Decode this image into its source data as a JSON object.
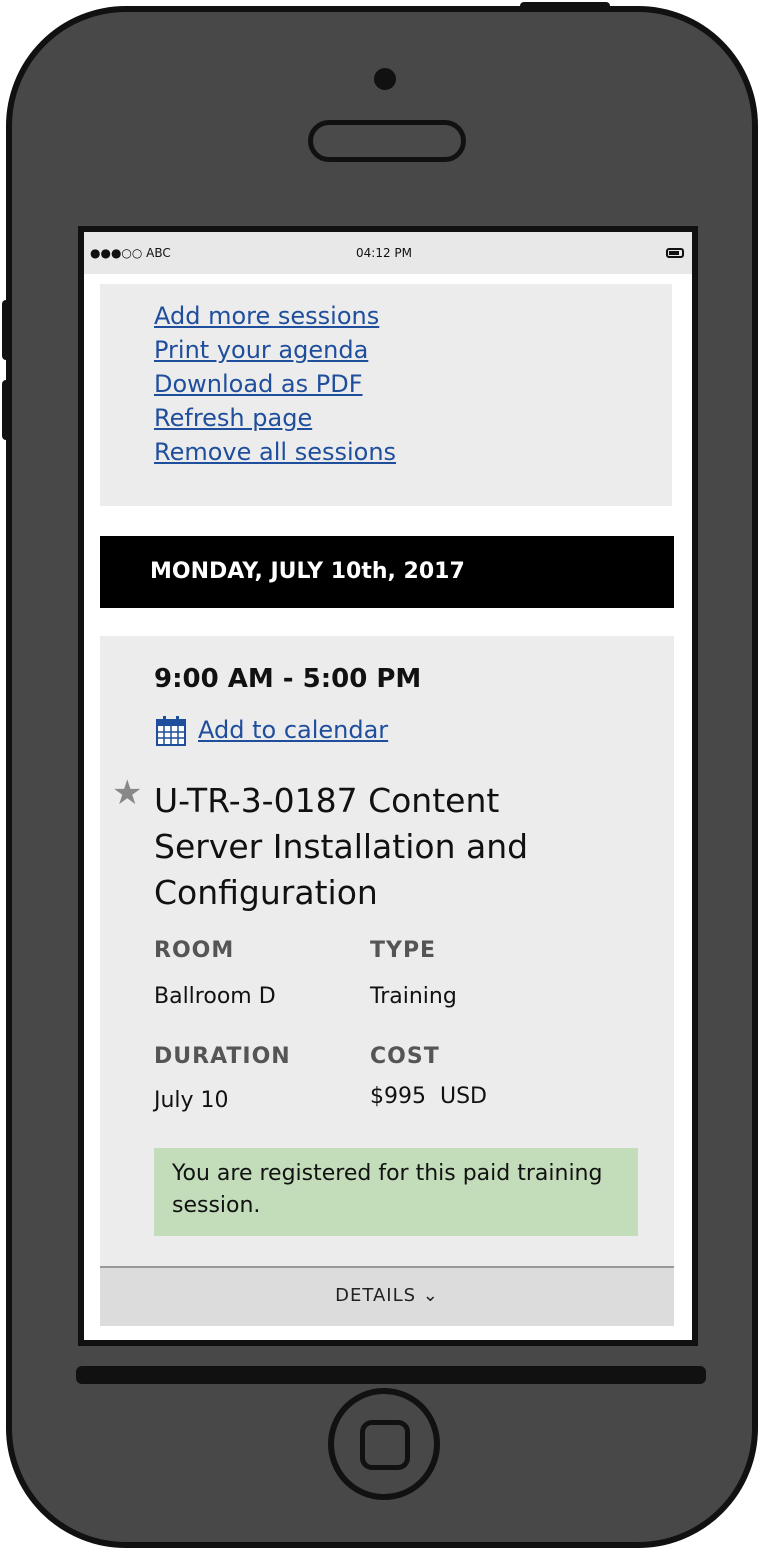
{
  "status_bar": {
    "signal": "●●●○○ ABC",
    "time": "04:12 PM"
  },
  "actions": {
    "add_more": "Add more sessions",
    "print": "Print your agenda",
    "download": "Download as PDF",
    "refresh": "Refresh page",
    "remove": "Remove all sessions"
  },
  "day_header": "MONDAY, JULY 10th, 2017",
  "session": {
    "time_range": "9:00 AM - 5:00 PM",
    "add_to_calendar": "Add to calendar",
    "title": "U-TR-3-0187 Content Server Installation and Configuration",
    "room_label": "ROOM",
    "room_value": "Ballroom D",
    "type_label": "TYPE",
    "type_value": "Training",
    "duration_label": "DURATION",
    "duration_value": "July 10",
    "cost_label": "COST",
    "cost_value": "$995  USD",
    "notice": "You are registered for this paid training session.",
    "details": "DETAILS",
    "details_icon": "chevron-down-icon",
    "favorite_icon": "star-icon",
    "calendar_icon": "calendar-icon"
  },
  "colors": {
    "link": "#1f4e9c",
    "notice_bg": "#c3ddbb",
    "header_bg": "#000000"
  }
}
